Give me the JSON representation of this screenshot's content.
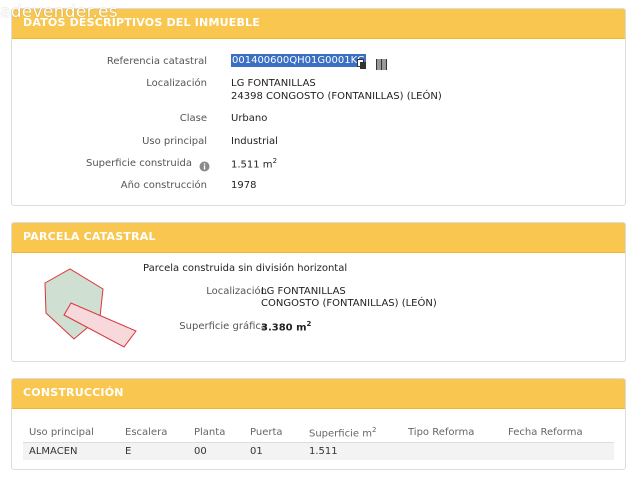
{
  "watermark": "adevender.es",
  "datos": {
    "title": "DATOS DESCRIPTIVOS DEL INMUEBLE",
    "referencia_label": "Referencia catastral",
    "referencia_value": "001400600QH01G0001KG",
    "localizacion_label": "Localización",
    "localizacion_line1": "LG FONTANILLAS",
    "localizacion_line2": "24398 CONGOSTO (FONTANILLAS) (LEÓN)",
    "clase_label": "Clase",
    "clase_value": "Urbano",
    "uso_label": "Uso principal",
    "uso_value": "Industrial",
    "superficie_label": "Superficie construida",
    "superficie_value": "1.511 m",
    "superficie_sup": "2",
    "anio_label": "Año construcción",
    "anio_value": "1978"
  },
  "parcela": {
    "title": "PARCELA CATASTRAL",
    "descripcion": "Parcela construida sin división horizontal",
    "localizacion_label": "Localización",
    "localizacion_line1": "LG FONTANILLAS",
    "localizacion_line2": "CONGOSTO (FONTANILLAS) (LEÓN)",
    "superficie_label": "Superficie gráfica",
    "superficie_value": "3.380 m",
    "superficie_sup": "2"
  },
  "construccion": {
    "title": "CONSTRUCCIÓN",
    "headers": [
      "Uso principal",
      "Escalera",
      "Planta",
      "Puerta",
      "Superficie m",
      "Tipo Reforma",
      "Fecha Reforma"
    ],
    "superficie_header_sup": "2",
    "rows": [
      [
        "ALMACEN",
        "E",
        "00",
        "01",
        "1.511",
        "",
        ""
      ]
    ]
  },
  "colors": {
    "header": "#f9c74f",
    "selection": "#3a6fc4",
    "plot_outline": "#d9343a",
    "plot_fill_green": "#cfe0d2",
    "plot_fill_pink": "#f7d9dc"
  },
  "icons": [
    "copy-icon",
    "barcode-icon",
    "info-icon"
  ]
}
